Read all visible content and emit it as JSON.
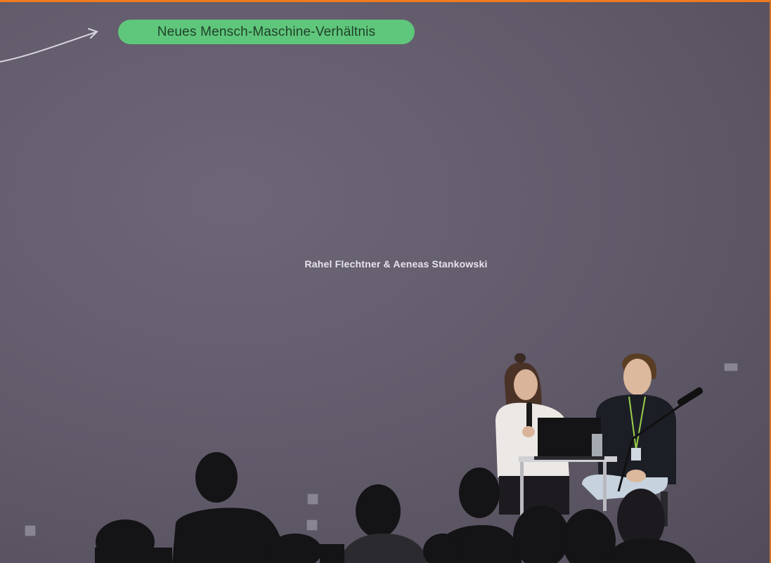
{
  "slide": {
    "tag_label": "Neues Mensch-Maschine-Verhältnis",
    "speakers": "Rahel Flechtner & Aeneas Stankowski"
  },
  "colors": {
    "frame_accent": "#f07a1e",
    "pill_background": "#5fc77b",
    "wall": "#5e5866"
  },
  "scene_elements": [
    "projection-wall",
    "curved-arrow-icon",
    "presenter-woman-with-microphone",
    "presenter-man",
    "laptop",
    "table",
    "microphone-stand",
    "audience-silhouettes"
  ]
}
